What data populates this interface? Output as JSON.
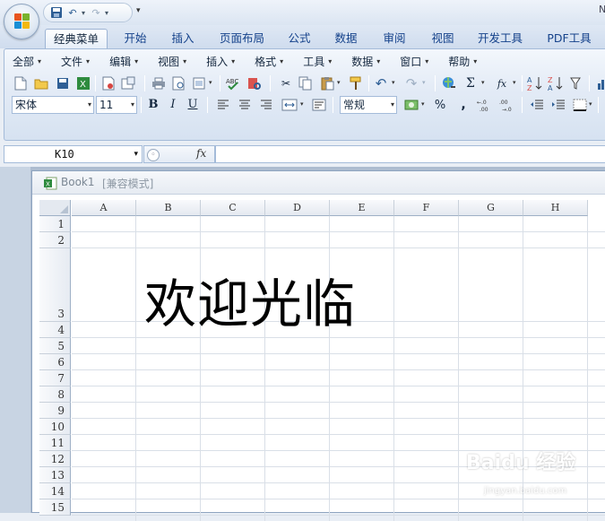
{
  "qat": {
    "more": "▾",
    "right_char": "N"
  },
  "tabs": [
    "经典菜单",
    "开始",
    "插入",
    "页面布局",
    "公式",
    "数据",
    "审阅",
    "视图",
    "开发工具",
    "PDF工具"
  ],
  "menu": [
    "全部",
    "文件",
    "编辑",
    "视图",
    "插入",
    "格式",
    "工具",
    "数据",
    "窗口",
    "帮助"
  ],
  "font": {
    "name": "宋体",
    "size": "11"
  },
  "format_buttons": {
    "bold": "B",
    "italic": "I",
    "underline": "U"
  },
  "number_format": "常规",
  "percent": "%",
  "comma": ",",
  "sigma": "Σ",
  "fx": "fx",
  "formula_bar": {
    "name_box": "K10",
    "fx_label": "fx",
    "value": ""
  },
  "workbook": {
    "name": "Book1",
    "mode": "[兼容模式]"
  },
  "columns": [
    "A",
    "B",
    "C",
    "D",
    "E",
    "F",
    "G",
    "H"
  ],
  "rows": [
    "1",
    "2",
    "3",
    "4",
    "5",
    "6",
    "7",
    "8",
    "9",
    "10",
    "11",
    "12",
    "13",
    "14",
    "15"
  ],
  "cell_text": {
    "B3": "欢迎光临"
  },
  "watermark": {
    "text": "Baidu 经验",
    "url": "jingyan.baidu.com"
  }
}
